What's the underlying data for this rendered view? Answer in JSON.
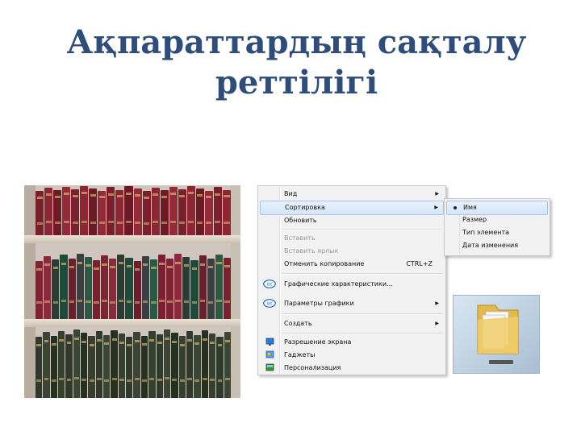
{
  "slide": {
    "title_line1": "Ақпараттардың сақталу",
    "title_line2": "реттілігі"
  },
  "context_menu": {
    "items": [
      {
        "label": "Вид",
        "submenu": true,
        "highlighted": false,
        "disabled": false
      },
      {
        "label": "Сортировка",
        "submenu": true,
        "highlighted": true,
        "disabled": false
      },
      {
        "label": "Обновить",
        "submenu": false,
        "highlighted": false,
        "disabled": false
      },
      {
        "label": "Вставить",
        "submenu": false,
        "highlighted": false,
        "disabled": true
      },
      {
        "label": "Вставить ярлык",
        "submenu": false,
        "highlighted": false,
        "disabled": true
      },
      {
        "label": "Отменить копирование",
        "shortcut": "CTRL+Z",
        "submenu": false,
        "highlighted": false,
        "disabled": false
      },
      {
        "label": "Графические характеристики...",
        "icon": "intel-graphics-icon",
        "submenu": false
      },
      {
        "label": "Параметры графики",
        "icon": "intel-graphics-icon",
        "submenu": true
      },
      {
        "label": "Создать",
        "submenu": true
      },
      {
        "label": "Разрешение экрана",
        "icon": "display-icon",
        "submenu": false
      },
      {
        "label": "Гаджеты",
        "icon": "gadgets-icon",
        "submenu": false
      },
      {
        "label": "Персонализация",
        "icon": "personalize-icon",
        "submenu": false
      }
    ]
  },
  "sort_submenu": {
    "items": [
      {
        "label": "Имя",
        "selected": true
      },
      {
        "label": "Размер",
        "selected": false
      },
      {
        "label": "Тип элемента",
        "selected": false
      },
      {
        "label": "Дата изменения",
        "selected": false
      }
    ]
  },
  "colors": {
    "title": "#2e4d7a",
    "menu_bg": "#f2f2f2",
    "highlight": "#d5e6f8"
  }
}
